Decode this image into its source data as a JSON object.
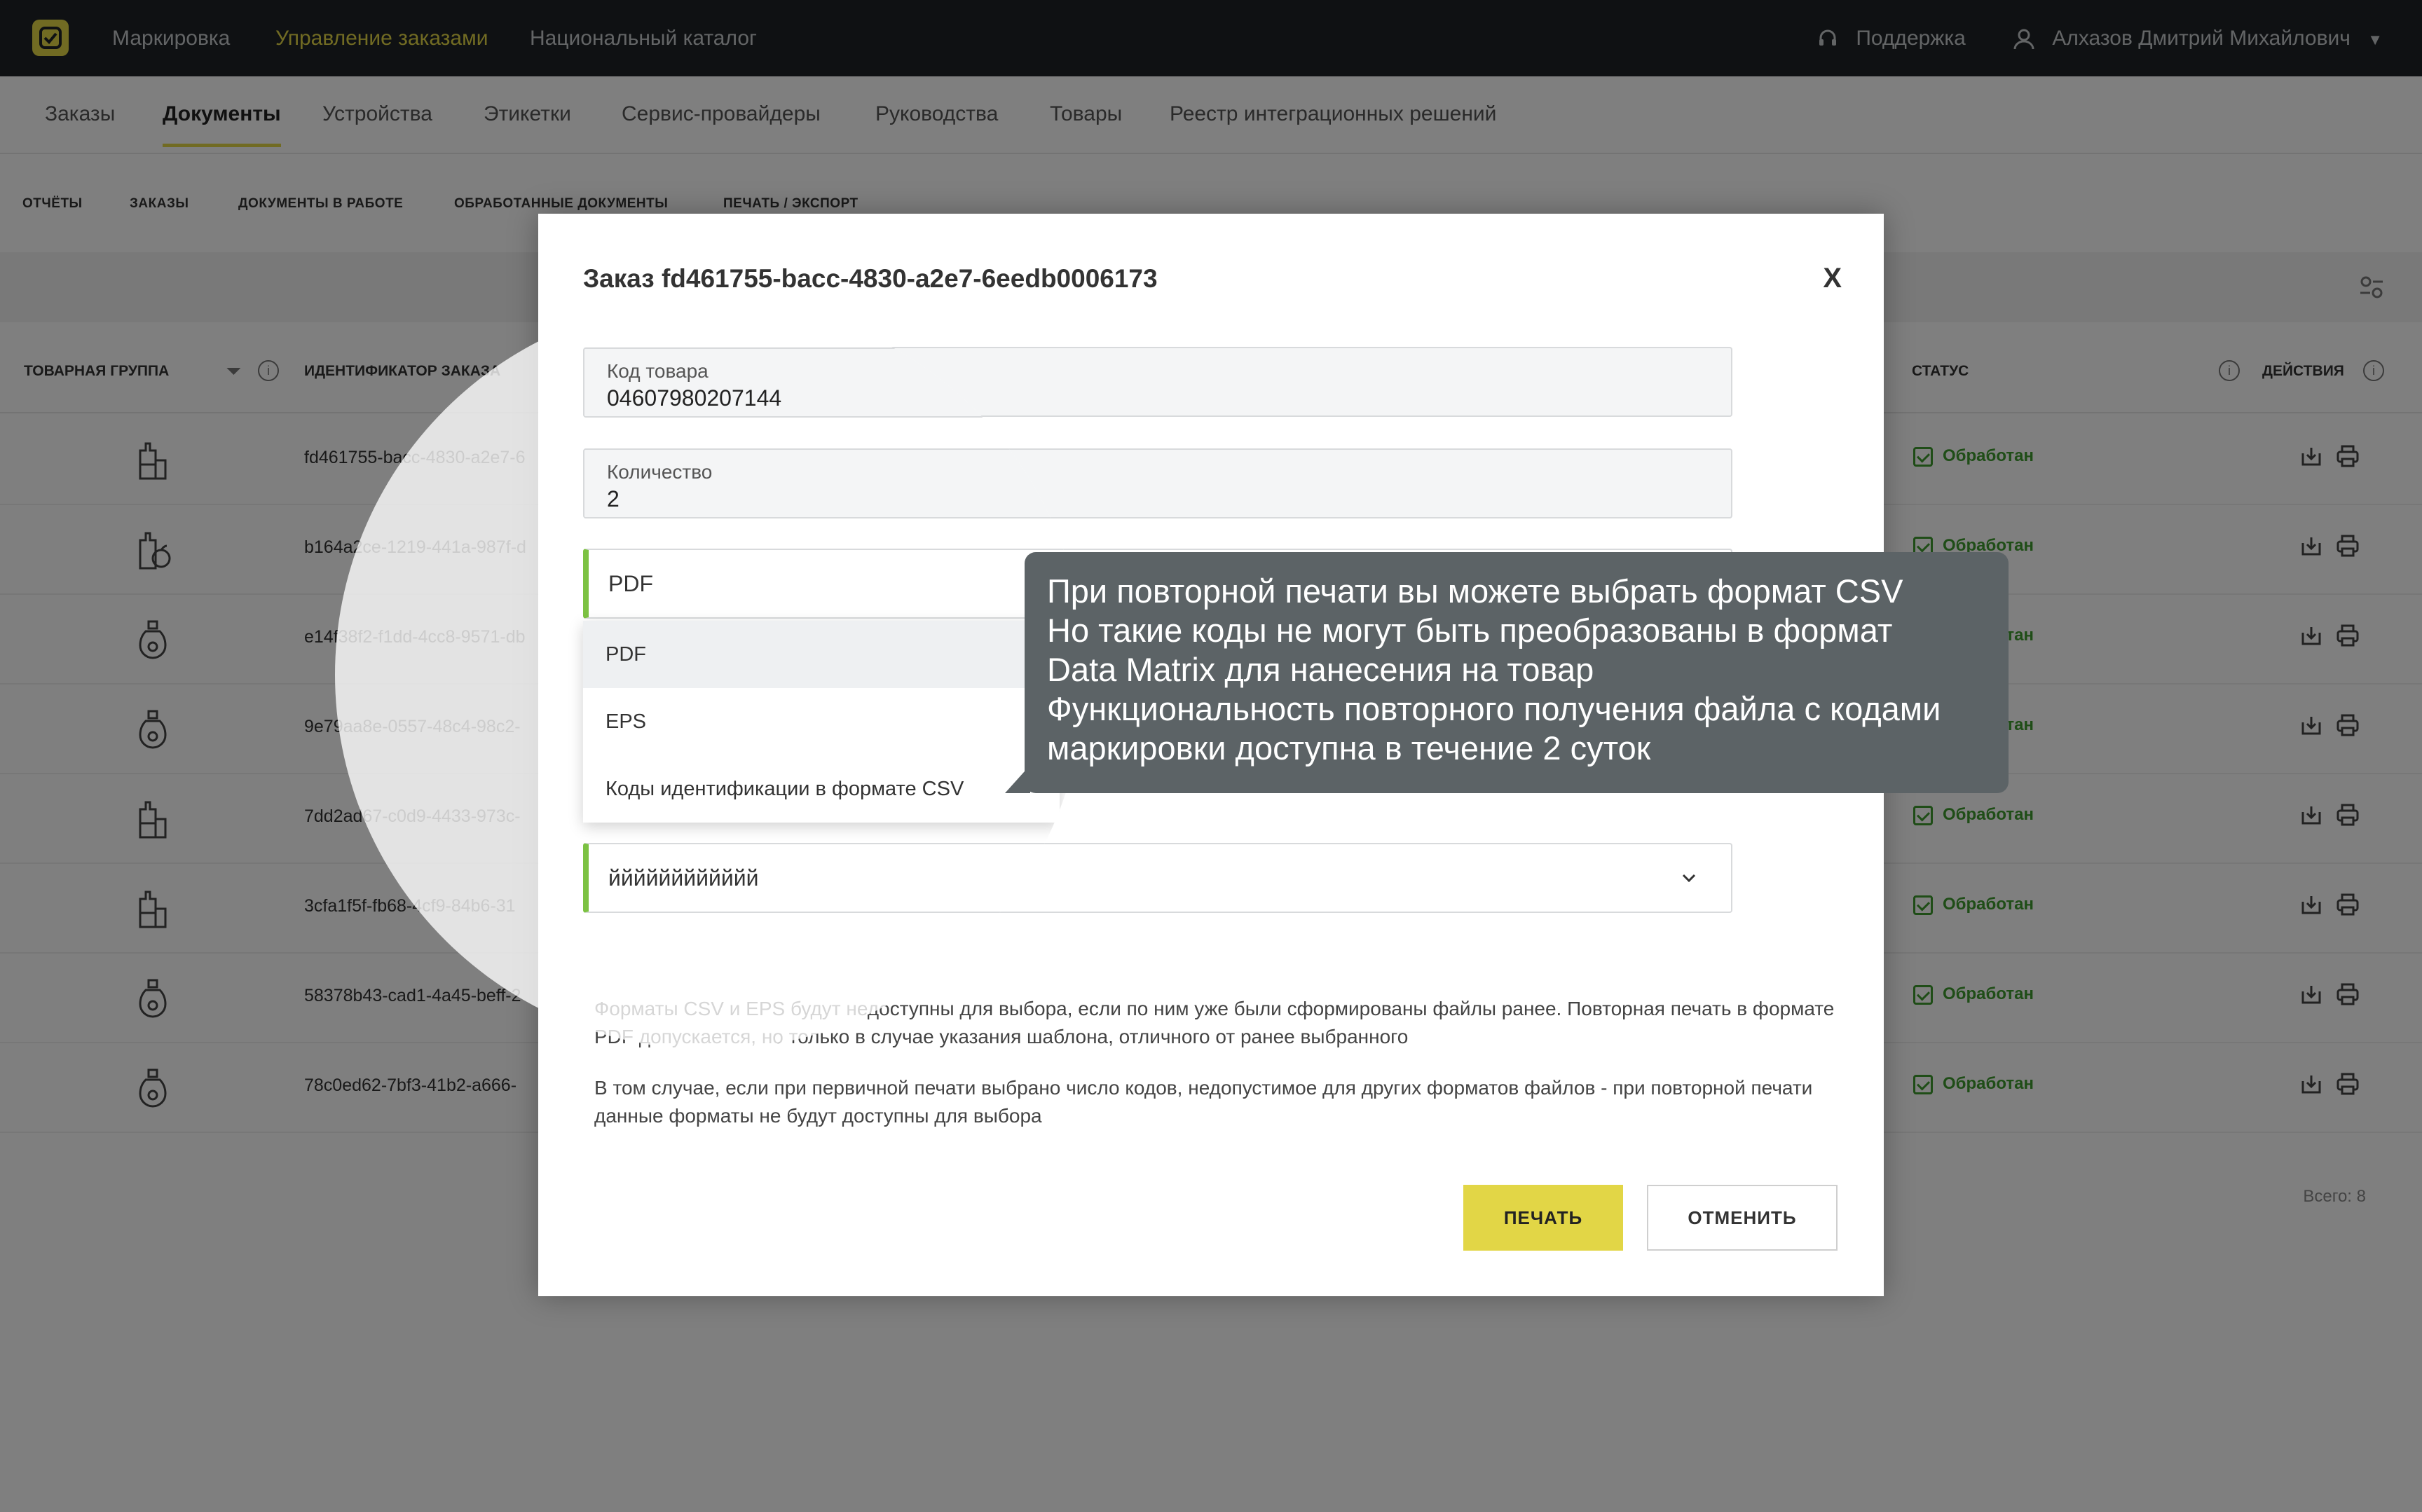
{
  "header": {
    "nav": [
      "Маркировка",
      "Управление заказами",
      "Национальный каталог"
    ],
    "support": "Поддержка",
    "user": "Алхазов Дмитрий Михайлович"
  },
  "subnav": [
    "Заказы",
    "Документы",
    "Устройства",
    "Этикетки",
    "Сервис-провайдеры",
    "Руководства",
    "Товары",
    "Реестр интеграционных решений"
  ],
  "filters": [
    "ОТЧЁТЫ",
    "ЗАКАЗЫ",
    "ДОКУМЕНТЫ В РАБОТЕ",
    "ОБРАБОТАННЫЕ ДОКУМЕНТЫ",
    "ПЕЧАТЬ / ЭКСПОРТ"
  ],
  "table": {
    "headers": {
      "group": "ТОВАРНАЯ ГРУППА",
      "id": "ИДЕНТИФИКАТОР ЗАКАЗА",
      "status": "СТАТУС",
      "actions": "ДЕЙСТВИЯ"
    },
    "rows": [
      {
        "id": "fd461755-bacc-4830-a2e7-6",
        "status": "Обработан",
        "icon": "bottles-icon"
      },
      {
        "id": "b164a2ce-1219-441a-987f-d",
        "status": "Обработан",
        "icon": "bottle-apple-icon"
      },
      {
        "id": "e14f38f2-f1dd-4cc8-9571-db",
        "status": "Обработан",
        "icon": "perfume-icon"
      },
      {
        "id": "9e79aa8e-0557-48c4-98c2-",
        "status": "Обработан",
        "icon": "perfume-icon"
      },
      {
        "id": "7dd2ad67-c0d9-4433-973c-",
        "status": "Обработан",
        "icon": "bottles-icon"
      },
      {
        "id": "3cfa1f5f-fb68-4cf9-84b6-31",
        "status": "Обработан",
        "icon": "bottles-icon"
      },
      {
        "id": "58378b43-cad1-4a45-beff-2",
        "status": "Обработан",
        "icon": "perfume-icon"
      },
      {
        "id": "78c0ed62-7bf3-41b2-a666-",
        "status": "Обработан",
        "icon": "perfume-icon"
      }
    ],
    "total": "Всего: 8"
  },
  "modal": {
    "title": "Заказ fd461755-bacc-4830-a2e7-6eedb0006173",
    "close": "X",
    "product_code_label": "Код товара",
    "product_code_value": "04607980207144",
    "quantity_label": "Количество",
    "quantity_value": "2",
    "format_selected": "PDF",
    "format_options": [
      "PDF",
      "EPS",
      "Коды идентификации в формате CSV"
    ],
    "template_selected": "йййййййййййй",
    "note1": "Форматы CSV и EPS будут недоступны для выбора, если по ним уже были сформированы файлы ранее. Повторная печать в формате PDF допускается, но только в случае указания шаблона, отличного от ранее выбранного",
    "note2": "В том случае, если при первичной печати выбрано число кодов, недопустимое для других форматов файлов - при повторной печати данные форматы не будут доступны для выбора",
    "print_button": "ПЕЧАТЬ",
    "cancel_button": "ОТМЕНИТЬ"
  },
  "callout": {
    "lines": [
      "При повторной печати вы можете выбрать формат CSV",
      "Но такие коды не могут быть преобразованы в формат",
      "Data Matrix для нанесения на товар",
      "Функциональность повторного получения файла с кодами",
      "маркировки доступна в течение 2 суток"
    ]
  },
  "colors": {
    "accent": "#e2d646",
    "topbar": "#1f2226",
    "status_green": "#3e9b2f",
    "select_bar": "#7cc242",
    "callout_bg": "#5c6366"
  }
}
